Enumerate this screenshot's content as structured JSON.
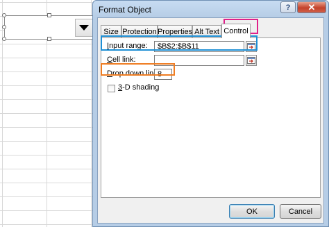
{
  "dialog": {
    "title": "Format Object",
    "help_label": "?",
    "close_label": "✕"
  },
  "tabs": [
    {
      "label": "Size"
    },
    {
      "label": "Protection"
    },
    {
      "label": "Properties"
    },
    {
      "label": "Alt Text"
    },
    {
      "label": "Control",
      "active": true
    }
  ],
  "control": {
    "input_range": {
      "label_underlined": "I",
      "label_rest": "nput range:",
      "value": "$B$2:$B$11"
    },
    "cell_link": {
      "label_underlined": "C",
      "label_rest": "ell link:",
      "value": ""
    },
    "drop_down_lines": {
      "label_underlined": "D",
      "label_rest": "rop down lines:",
      "value": "8"
    },
    "shading": {
      "label_underlined": "3",
      "label_rest": "-D shading",
      "checked": false
    }
  },
  "buttons": {
    "ok": "OK",
    "cancel": "Cancel"
  },
  "highlight_colors": {
    "tab": "#e0218a",
    "input_range": "#1e8fd5",
    "drop_down": "#ef7d22"
  },
  "icons": {
    "dropdown": "triangle-down-icon",
    "ref": "range-select-icon"
  }
}
